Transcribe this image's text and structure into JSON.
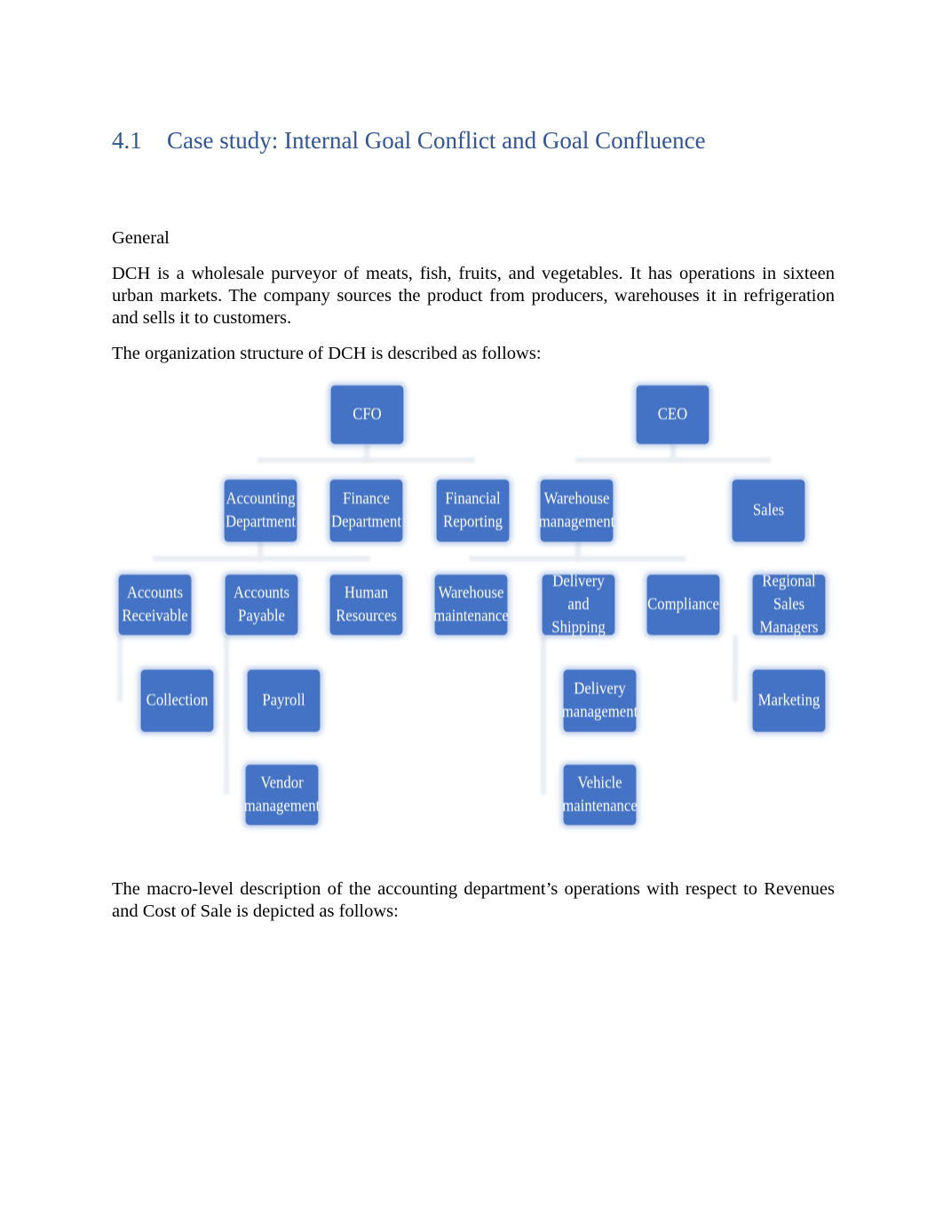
{
  "heading": {
    "number": "4.1",
    "title": "Case study: Internal Goal Conflict and Goal Confluence"
  },
  "paragraphs": {
    "general": "General",
    "description": "DCH is a wholesale purveyor of meats, fish, fruits, and vegetables. It has operations in sixteen urban markets. The company sources the product from producers, warehouses it in refrigeration and sells it to customers.",
    "org_intro": "The organization structure of DCH is described as follows:",
    "macro": "The macro-level description of the accounting department’s operations with respect to Revenues and Cost of Sale is depicted as follows:"
  },
  "org_chart": {
    "cfo": "CFO",
    "ceo": "CEO",
    "accounting_department": "Accounting Department",
    "finance_department": "Finance Department",
    "financial_reporting": "Financial Reporting",
    "warehouse_management": "Warehouse management",
    "sales": "Sales",
    "accounts_receivable": "Accounts Receivable",
    "accounts_payable": "Accounts Payable",
    "human_resources": "Human Resources",
    "warehouse_maintenance": "Warehouse maintenance",
    "delivery_and_shipping": "Delivery and Shipping",
    "compliance": "Compliance",
    "regional_sales_managers": "Regional Sales Managers",
    "collection": "Collection",
    "payroll": "Payroll",
    "delivery_management": "Delivery management",
    "marketing": "Marketing",
    "vendor_management": "Vendor management",
    "vehicle_maintenance": "Vehicle maintenance"
  }
}
